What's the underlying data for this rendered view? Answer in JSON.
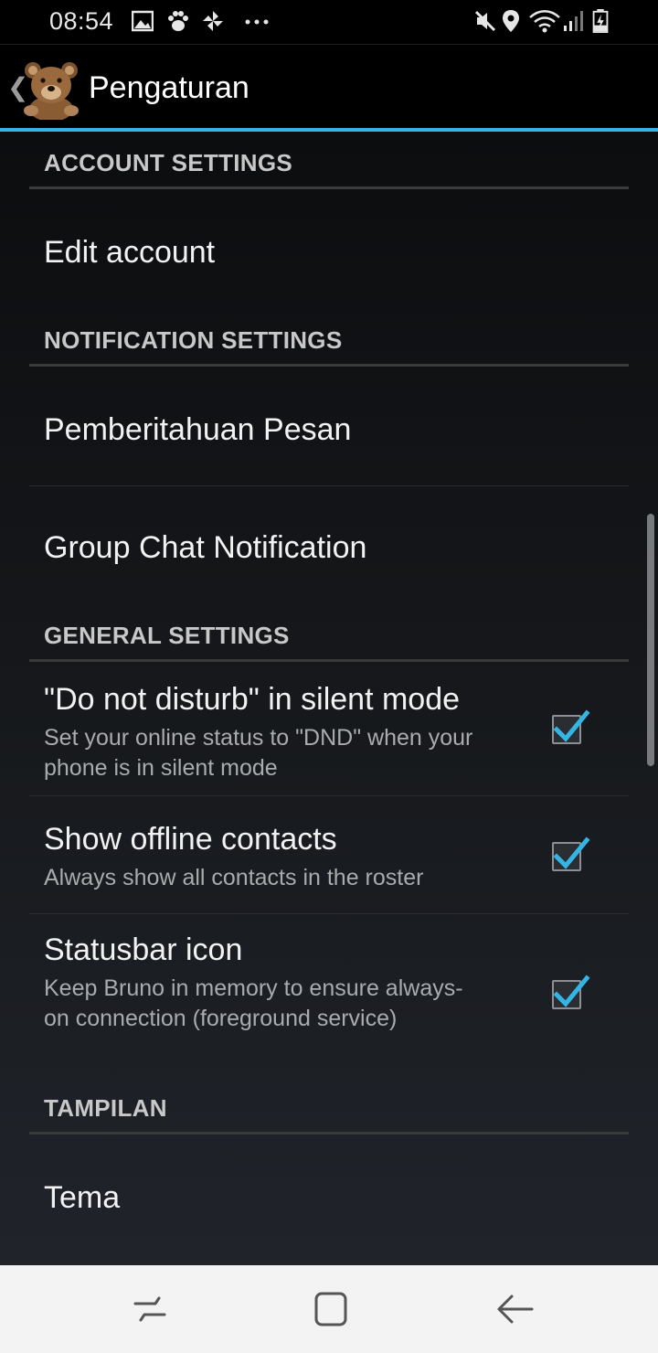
{
  "status_bar": {
    "time": "08:54",
    "left_icons": [
      "gallery-icon",
      "paw-icon",
      "pinwheel-icon",
      "more-dots-icon"
    ],
    "right_icons": [
      "mute-icon",
      "location-icon",
      "wifi-icon",
      "signal-icon",
      "battery-charging-icon"
    ]
  },
  "action_bar": {
    "title": "Pengaturan",
    "back_icon": "chevron-left-icon",
    "accent_color": "#33b5e5"
  },
  "sections": {
    "account": {
      "header": "ACCOUNT SETTINGS",
      "items": [
        {
          "title": "Edit account"
        }
      ]
    },
    "notification": {
      "header": "NOTIFICATION SETTINGS",
      "items": [
        {
          "title": "Pemberitahuan Pesan"
        },
        {
          "title": "Group Chat Notification"
        }
      ]
    },
    "general": {
      "header": "GENERAL SETTINGS",
      "items": [
        {
          "title": "\"Do not disturb\" in silent mode",
          "summary": "Set your online status to \"DND\" when your phone is in silent mode",
          "checked": true
        },
        {
          "title": "Show offline contacts",
          "summary": "Always show all contacts in the roster",
          "checked": true
        },
        {
          "title": "Statusbar icon",
          "summary": "Keep Bruno in memory to ensure always-on connection (foreground service)",
          "checked": true
        }
      ]
    },
    "display": {
      "header": "TAMPILAN",
      "items": [
        {
          "title": "Tema"
        }
      ]
    }
  },
  "nav_bar": {
    "buttons": [
      "recent-apps-icon",
      "home-icon",
      "back-arrow-icon"
    ]
  },
  "colors": {
    "check_mark": "#33b5e5",
    "section_text": "#c8c8c8",
    "summary_text": "#a9abad"
  }
}
